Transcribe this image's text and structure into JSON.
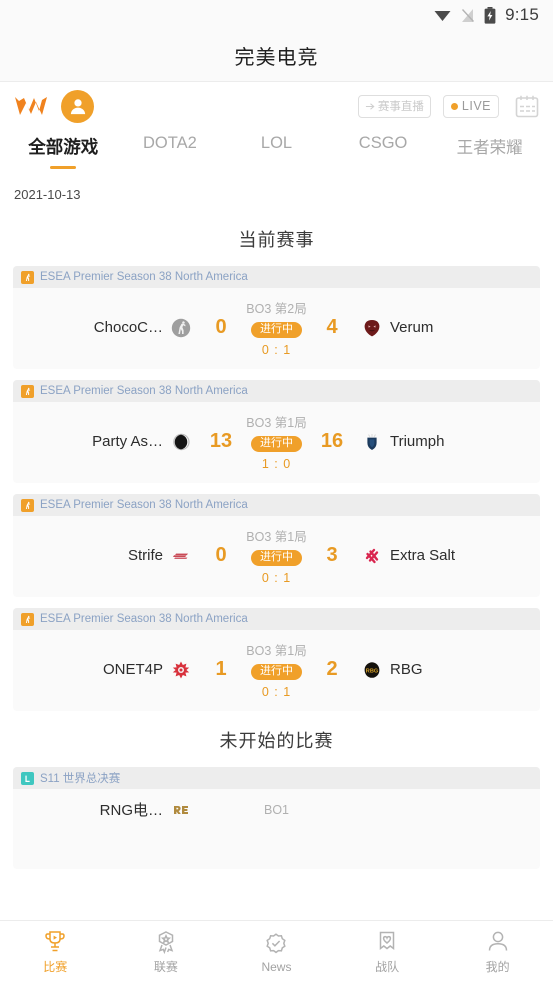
{
  "status_bar": {
    "time": "9:15",
    "icons": [
      "wifi-icon",
      "signal-off-icon",
      "battery-charging-icon"
    ]
  },
  "app_bar": {
    "title": "完美电竞"
  },
  "toolbar": {
    "logo": "wm-logo-icon",
    "avatar": "account-avatar-icon",
    "live_room_label": "赛事直播",
    "live_label": "LIVE",
    "calendar": "calendar-icon"
  },
  "tabs": [
    {
      "label": "全部游戏",
      "active": true
    },
    {
      "label": "DOTA2",
      "active": false
    },
    {
      "label": "LOL",
      "active": false
    },
    {
      "label": "CSGO",
      "active": false
    },
    {
      "label": "王者荣耀",
      "active": false
    }
  ],
  "date": "2021-10-13",
  "sections": [
    {
      "title": "当前赛事"
    },
    {
      "title": "未开始的比赛"
    }
  ],
  "colors": {
    "accent": "#f0a02a",
    "score": "#e89a23",
    "league_text": "#8ba2c4",
    "muted": "#b0b0b0"
  },
  "live_matches": [
    {
      "game": "csgo",
      "league": "ESEA Premier Season 38 North America",
      "team_left": "ChocoC…",
      "team_right": "Verum",
      "score_left": "0",
      "score_right": "4",
      "bo": "BO3 第2局",
      "status": "进行中",
      "series": "0 : 1",
      "logo_left": "chococ-team-logo",
      "logo_right": "verum-team-logo"
    },
    {
      "game": "csgo",
      "league": "ESEA Premier Season 38 North America",
      "team_left": "Party As…",
      "team_right": "Triumph",
      "score_left": "13",
      "score_right": "16",
      "bo": "BO3 第1局",
      "status": "进行中",
      "series": "1 : 0",
      "logo_left": "party-astronauts-team-logo",
      "logo_right": "triumph-team-logo"
    },
    {
      "game": "csgo",
      "league": "ESEA Premier Season 38 North America",
      "team_left": "Strife",
      "team_right": "Extra Salt",
      "score_left": "0",
      "score_right": "3",
      "bo": "BO3 第1局",
      "status": "进行中",
      "series": "0 : 1",
      "logo_left": "strife-team-logo",
      "logo_right": "extra-salt-team-logo"
    },
    {
      "game": "csgo",
      "league": "ESEA Premier Season 38 North America",
      "team_left": "ONET4P",
      "team_right": "RBG",
      "score_left": "1",
      "score_right": "2",
      "bo": "BO3 第1局",
      "status": "进行中",
      "series": "0 : 1",
      "logo_left": "onet4p-team-logo",
      "logo_right": "rbg-team-logo"
    }
  ],
  "upcoming_matches": [
    {
      "game": "lol",
      "league": "S11 世界总决赛",
      "team_left": "RNG电…",
      "bo": "BO1",
      "logo_left": "rng-team-logo"
    }
  ],
  "bottom_nav": [
    {
      "label": "比赛",
      "icon": "trophy-icon",
      "active": true
    },
    {
      "label": "联赛",
      "icon": "medal-icon",
      "active": false
    },
    {
      "label": "News",
      "icon": "check-badge-icon",
      "active": false
    },
    {
      "label": "战队",
      "icon": "bookmark-heart-icon",
      "active": false
    },
    {
      "label": "我的",
      "icon": "person-icon",
      "active": false
    }
  ]
}
